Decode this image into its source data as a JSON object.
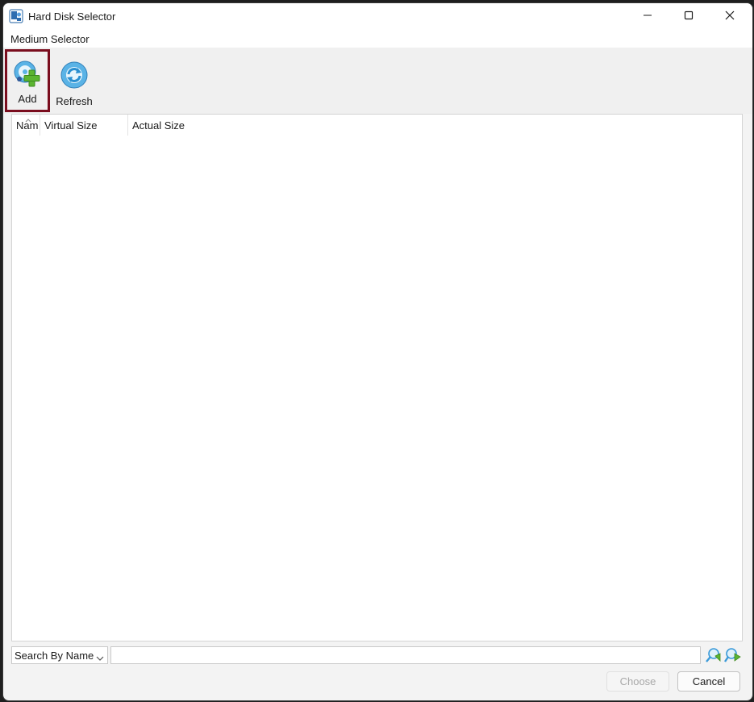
{
  "window": {
    "title": "Hard Disk Selector"
  },
  "header": {
    "label": "Medium Selector"
  },
  "toolbar": {
    "add_label": "Add",
    "refresh_label": "Refresh"
  },
  "list": {
    "columns": [
      "Nam",
      "Virtual Size",
      "Actual Size"
    ],
    "rows": []
  },
  "search": {
    "mode": "Search By Name",
    "value": ""
  },
  "buttons": {
    "choose": "Choose",
    "cancel": "Cancel"
  },
  "colors": {
    "highlight_border": "#7a0d1e",
    "accent_green": "#5cb531",
    "accent_blue": "#4aa8de"
  },
  "icons": {
    "app": "virtualbox-media-icon",
    "add": "add-disk-icon",
    "refresh": "refresh-icon",
    "search_prev": "search-previous-icon",
    "search_next": "search-next-icon"
  }
}
